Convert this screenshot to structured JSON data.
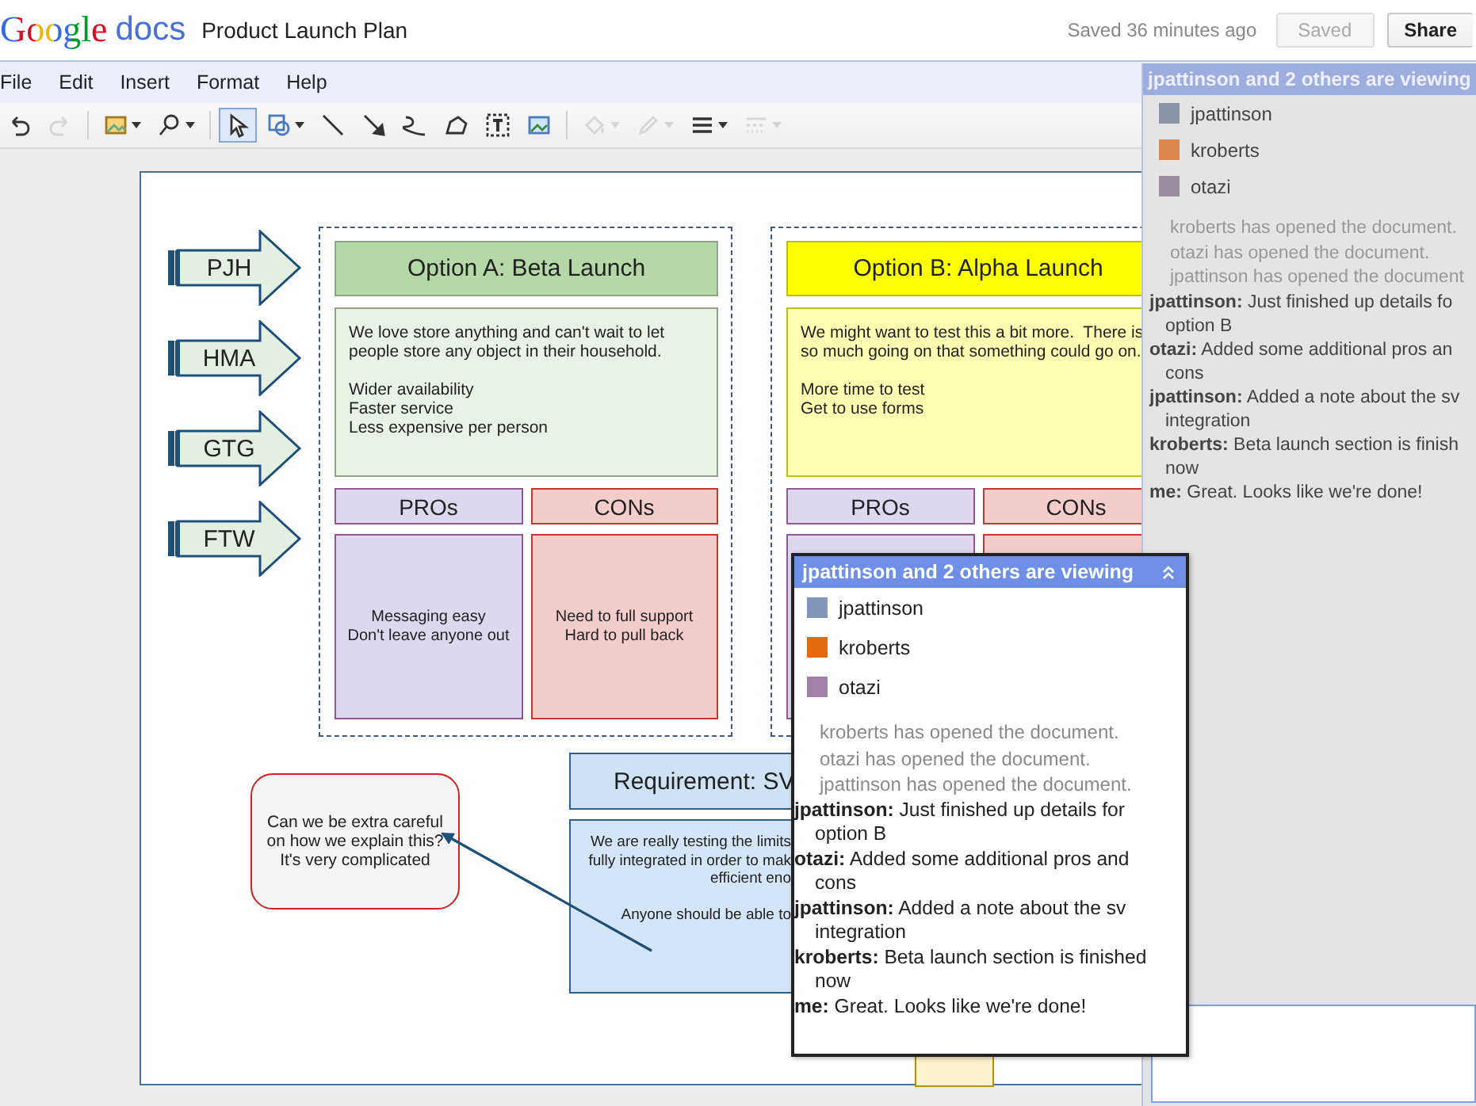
{
  "app": {
    "logo": "Google",
    "product": "docs",
    "title": "Product Launch Plan",
    "save_status": "Saved 36 minutes ago",
    "saved_button": {
      "label": "Saved",
      "disabled": true
    },
    "share_button": "Share"
  },
  "menu": [
    "File",
    "Edit",
    "Insert",
    "Format",
    "Help"
  ],
  "toolbar": [
    {
      "kind": "undo",
      "caret": false,
      "selected": false,
      "disabled": false
    },
    {
      "kind": "redo",
      "caret": false,
      "selected": false,
      "disabled": true
    },
    {
      "kind": "background",
      "caret": true,
      "selected": false,
      "disabled": false
    },
    {
      "kind": "zoom",
      "caret": true,
      "selected": false,
      "disabled": false
    },
    {
      "kind": "select",
      "caret": false,
      "selected": true,
      "disabled": false
    },
    {
      "kind": "shape",
      "caret": true,
      "selected": false,
      "disabled": false
    },
    {
      "kind": "line",
      "caret": false,
      "selected": false,
      "disabled": false
    },
    {
      "kind": "arrow",
      "caret": false,
      "selected": false,
      "disabled": false
    },
    {
      "kind": "curve",
      "caret": false,
      "selected": false,
      "disabled": false
    },
    {
      "kind": "polyline",
      "caret": false,
      "selected": false,
      "disabled": false
    },
    {
      "kind": "textbox",
      "caret": false,
      "selected": false,
      "disabled": false
    },
    {
      "kind": "image",
      "caret": false,
      "selected": false,
      "disabled": false
    },
    {
      "kind": "fill",
      "caret": true,
      "selected": false,
      "disabled": true
    },
    {
      "kind": "pen",
      "caret": true,
      "selected": false,
      "disabled": true
    },
    {
      "kind": "weight",
      "caret": true,
      "selected": false,
      "disabled": false
    },
    {
      "kind": "dash",
      "caret": true,
      "selected": false,
      "disabled": true
    }
  ],
  "diagram": {
    "tags": [
      "PJH",
      "HMA",
      "GTG",
      "FTW"
    ],
    "options": [
      {
        "title": "Option A: Beta Launch",
        "color": "#b6d7a8",
        "intro": [
          "We love store anything and can't wait to let",
          "people store any object in their household."
        ],
        "points": [
          "Wider availability",
          "Faster service",
          "Less expensive per person"
        ],
        "pros_label": "PROs",
        "cons_label": "CONs",
        "pros": [
          "Messaging easy",
          "Don't leave anyone out"
        ],
        "cons": [
          "Need to full support",
          "Hard to pull back"
        ]
      },
      {
        "title": "Option B: Alpha Launch",
        "color": "#ffff00",
        "intro": [
          "We might want to test this a bit more.  There is",
          "so much going on that something could go on."
        ],
        "points": [
          "More time to test",
          "Get to use forms"
        ],
        "pros_label": "PROs",
        "cons_label": "CONs"
      }
    ],
    "requirement": {
      "title": "Requirement: SV",
      "lines": [
        "We are really testing the limits",
        "fully integrated in order to mak",
        "efficient eno"
      ],
      "lines2": [
        "Anyone should be able to"
      ]
    },
    "note": "Can we be extra careful on how we explain this?  It's very complicated"
  },
  "viewers_popup": {
    "header": "jpattinson and 2 others are viewing",
    "members": [
      {
        "name": "jpattinson",
        "color": "#8296ba"
      },
      {
        "name": "kroberts",
        "color": "#e2690c"
      },
      {
        "name": "otazi",
        "color": "#a083a4"
      }
    ],
    "events": [
      "kroberts has opened the document.",
      "otazi has opened the document.",
      "jpattinson has opened the document."
    ],
    "messages": [
      {
        "author": "jpattinson:",
        "text": "Just finished up details for option B"
      },
      {
        "author": "otazi:",
        "text": "Added some additional pros and cons"
      },
      {
        "author": "jpattinson:",
        "text": "Added a note about the sv integration"
      },
      {
        "author": "kroberts:",
        "text": "Beta launch section is finished now"
      },
      {
        "author": "me:",
        "text": "Great. Looks like we're done!"
      }
    ]
  },
  "chat_panel": {
    "header": "jpattinson and 2 others are viewing",
    "members": [
      {
        "name": "jpattinson",
        "color": "#8b93a6"
      },
      {
        "name": "kroberts",
        "color": "#d9874e"
      },
      {
        "name": "otazi",
        "color": "#9a8f9e"
      }
    ],
    "events": [
      "kroberts has opened the document.",
      "otazi has opened the document.",
      "jpattinson has opened the document"
    ],
    "messages": [
      {
        "author": "jpattinson:",
        "lines": [
          "Just finished up details fo",
          "option B"
        ]
      },
      {
        "author": "otazi:",
        "lines": [
          "Added some additional pros an",
          "cons"
        ]
      },
      {
        "author": "jpattinson:",
        "lines": [
          "Added a note about the sv",
          "integration"
        ]
      },
      {
        "author": "kroberts:",
        "lines": [
          "Beta launch section is finish",
          "now"
        ]
      },
      {
        "author": "me:",
        "lines": [
          "Great. Looks like we're done!"
        ]
      }
    ]
  }
}
